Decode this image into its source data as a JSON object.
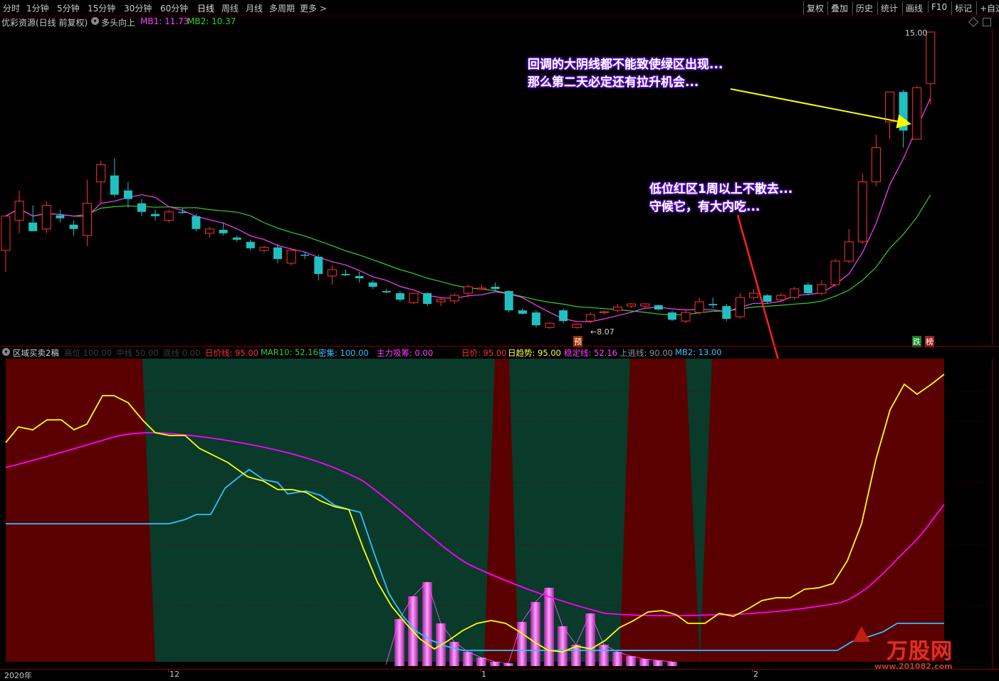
{
  "toolbar": {
    "periods": [
      "分时",
      "1分钟",
      "5分钟",
      "15分钟",
      "30分钟",
      "60分钟",
      "日线",
      "周线",
      "月线",
      "多周期",
      "更多 >"
    ],
    "right_buttons": [
      "复权",
      "叠加",
      "历史",
      "统计",
      "画线",
      "F10",
      "标记",
      "+自选"
    ]
  },
  "main_title": {
    "stock": "优彩资源(日线 前复权)",
    "indicator": "多头向上",
    "mb1": "MB1: 11.73",
    "mb2": "MB2: 10.37"
  },
  "labels": {
    "high_price": "15.00",
    "low_price": "8.07",
    "pre_marker": "预",
    "tag1": "跌",
    "tag2": "榜"
  },
  "annotations": {
    "a1_line1": "回调的大阴线都不能致使绿区出现...",
    "a1_line2": "那么第二天必定还有拉升机会...",
    "a2_line1": "低位红区1周以上不散去...",
    "a2_line2": "守候它，有大内吃..."
  },
  "indicator_row": {
    "name": "区域买卖2稿",
    "ghost1": "高位 100.00",
    "ghost2": "中线 50.00",
    "ghost3": "底线 0.00",
    "rijia": "日价线: 95.00",
    "mar10": "MAR10: 52.16",
    "miji": "密集: 100.00",
    "zhuli": "主力吸筹: 0.00",
    "rijia2": "日价: 95.00",
    "riqushi": "日趋势: 95.00",
    "wending": "稳定线: 52.16",
    "shangtao": "上逃线: 90.00",
    "mb2": "MB2: 13.00"
  },
  "dates": {
    "year": "2020年",
    "d12": "12",
    "d1": "1",
    "d2": "2"
  },
  "watermark": {
    "logo": "万股网",
    "url": "www.201082.com"
  },
  "colors": {
    "up": "#ff3232",
    "down": "#20c0c0",
    "ma_fast": "#ff40ff",
    "ma_slow": "#30d030",
    "zone_red": "#5a0000",
    "zone_green": "#0a3a2a",
    "yellow": "#ffff00",
    "magenta": "#ff00ff",
    "cyan": "#30c0ff",
    "bar_pink": "#ff60ff"
  },
  "chart_data": [
    {
      "type": "candlestick",
      "title": "优彩资源(日线 前复权)",
      "note": "OHLC estimated from the price ticks, which are not printed except for the marked extremes 15.00 and 8.07",
      "candles": [
        {
          "o": 9.9,
          "h": 10.6,
          "l": 9.4,
          "c": 10.7,
          "dir": "up"
        },
        {
          "o": 10.6,
          "h": 11.3,
          "l": 10.3,
          "c": 11.05,
          "dir": "up"
        },
        {
          "o": 10.55,
          "h": 10.95,
          "l": 10.35,
          "c": 10.35,
          "dir": "down"
        },
        {
          "o": 10.4,
          "h": 11.05,
          "l": 10.3,
          "c": 10.95,
          "dir": "up"
        },
        {
          "o": 10.72,
          "h": 10.85,
          "l": 10.55,
          "c": 10.65,
          "dir": "down"
        },
        {
          "o": 10.4,
          "h": 10.6,
          "l": 10.25,
          "c": 10.5,
          "dir": "down"
        },
        {
          "o": 10.25,
          "h": 11.55,
          "l": 10.0,
          "c": 11.0,
          "dir": "up"
        },
        {
          "o": 11.5,
          "h": 12.0,
          "l": 11.0,
          "c": 11.9,
          "dir": "up"
        },
        {
          "o": 11.65,
          "h": 12.05,
          "l": 11.15,
          "c": 11.2,
          "dir": "down"
        },
        {
          "o": 11.3,
          "h": 11.5,
          "l": 10.9,
          "c": 11.1,
          "dir": "down"
        },
        {
          "o": 11.0,
          "h": 11.1,
          "l": 10.7,
          "c": 10.8,
          "dir": "down"
        },
        {
          "o": 10.75,
          "h": 10.85,
          "l": 10.6,
          "c": 10.7,
          "dir": "down"
        },
        {
          "o": 10.6,
          "h": 10.85,
          "l": 10.55,
          "c": 10.8,
          "dir": "up"
        },
        {
          "o": 10.8,
          "h": 10.9,
          "l": 10.75,
          "c": 10.78,
          "dir": "down"
        },
        {
          "o": 10.7,
          "h": 10.75,
          "l": 10.35,
          "c": 10.4,
          "dir": "down"
        },
        {
          "o": 10.3,
          "h": 10.45,
          "l": 10.2,
          "c": 10.4,
          "dir": "up"
        },
        {
          "o": 10.38,
          "h": 10.55,
          "l": 10.25,
          "c": 10.3,
          "dir": "down"
        },
        {
          "o": 10.2,
          "h": 10.25,
          "l": 10.1,
          "c": 10.15,
          "dir": "down"
        },
        {
          "o": 10.1,
          "h": 10.15,
          "l": 9.9,
          "c": 9.95,
          "dir": "down"
        },
        {
          "o": 9.9,
          "h": 10.0,
          "l": 9.85,
          "c": 9.97,
          "dir": "up"
        },
        {
          "o": 9.97,
          "h": 10.05,
          "l": 9.6,
          "c": 9.7,
          "dir": "down"
        },
        {
          "o": 9.6,
          "h": 9.95,
          "l": 9.55,
          "c": 9.9,
          "dir": "up"
        },
        {
          "o": 9.8,
          "h": 9.85,
          "l": 9.7,
          "c": 9.78,
          "dir": "down"
        },
        {
          "o": 9.75,
          "h": 9.8,
          "l": 9.2,
          "c": 9.35,
          "dir": "down"
        },
        {
          "o": 9.3,
          "h": 9.55,
          "l": 9.1,
          "c": 9.45,
          "dir": "up"
        },
        {
          "o": 9.35,
          "h": 9.45,
          "l": 9.3,
          "c": 9.32,
          "dir": "down"
        },
        {
          "o": 9.3,
          "h": 9.4,
          "l": 9.15,
          "c": 9.25,
          "dir": "down"
        },
        {
          "o": 9.15,
          "h": 9.2,
          "l": 9.0,
          "c": 9.05,
          "dir": "down"
        },
        {
          "o": 8.95,
          "h": 9.0,
          "l": 8.9,
          "c": 8.92,
          "dir": "down"
        },
        {
          "o": 8.9,
          "h": 8.95,
          "l": 8.7,
          "c": 8.75,
          "dir": "down"
        },
        {
          "o": 8.68,
          "h": 8.92,
          "l": 8.65,
          "c": 8.9,
          "dir": "up"
        },
        {
          "o": 8.9,
          "h": 8.92,
          "l": 8.6,
          "c": 8.65,
          "dir": "down"
        },
        {
          "o": 8.7,
          "h": 8.8,
          "l": 8.6,
          "c": 8.75,
          "dir": "up"
        },
        {
          "o": 8.72,
          "h": 8.9,
          "l": 8.65,
          "c": 8.85,
          "dir": "up"
        },
        {
          "o": 8.9,
          "h": 9.1,
          "l": 8.8,
          "c": 9.05,
          "dir": "up"
        },
        {
          "o": 9.0,
          "h": 9.1,
          "l": 8.98,
          "c": 9.02,
          "dir": "up"
        },
        {
          "o": 9.05,
          "h": 9.15,
          "l": 8.95,
          "c": 9.0,
          "dir": "down"
        },
        {
          "o": 8.95,
          "h": 8.97,
          "l": 8.45,
          "c": 8.5,
          "dir": "down"
        },
        {
          "o": 8.5,
          "h": 8.55,
          "l": 8.4,
          "c": 8.42,
          "dir": "down"
        },
        {
          "o": 8.45,
          "h": 8.5,
          "l": 8.1,
          "c": 8.15,
          "dir": "down"
        },
        {
          "o": 8.1,
          "h": 8.22,
          "l": 8.07,
          "c": 8.2,
          "dir": "up"
        },
        {
          "o": 8.5,
          "h": 8.55,
          "l": 8.2,
          "c": 8.25,
          "dir": "down"
        },
        {
          "o": 8.1,
          "h": 8.2,
          "l": 8.07,
          "c": 8.18,
          "dir": "up"
        },
        {
          "o": 8.25,
          "h": 8.45,
          "l": 8.2,
          "c": 8.4,
          "dir": "up"
        },
        {
          "o": 8.45,
          "h": 8.5,
          "l": 8.4,
          "c": 8.47,
          "dir": "up"
        },
        {
          "o": 8.5,
          "h": 8.65,
          "l": 8.45,
          "c": 8.58,
          "dir": "up"
        },
        {
          "o": 8.6,
          "h": 8.67,
          "l": 8.55,
          "c": 8.65,
          "dir": "up"
        },
        {
          "o": 8.6,
          "h": 8.67,
          "l": 8.55,
          "c": 8.65,
          "dir": "up"
        },
        {
          "o": 8.62,
          "h": 8.63,
          "l": 8.5,
          "c": 8.52,
          "dir": "down"
        },
        {
          "o": 8.45,
          "h": 8.5,
          "l": 8.25,
          "c": 8.28,
          "dir": "down"
        },
        {
          "o": 8.25,
          "h": 8.5,
          "l": 8.2,
          "c": 8.45,
          "dir": "up"
        },
        {
          "o": 8.45,
          "h": 8.8,
          "l": 8.4,
          "c": 8.7,
          "dir": "up"
        },
        {
          "o": 8.65,
          "h": 8.8,
          "l": 8.55,
          "c": 8.62,
          "dir": "down"
        },
        {
          "o": 8.6,
          "h": 8.65,
          "l": 8.25,
          "c": 8.3,
          "dir": "down"
        },
        {
          "o": 8.35,
          "h": 8.9,
          "l": 8.3,
          "c": 8.8,
          "dir": "up"
        },
        {
          "o": 8.8,
          "h": 9.0,
          "l": 8.75,
          "c": 8.9,
          "dir": "up"
        },
        {
          "o": 8.85,
          "h": 8.88,
          "l": 8.65,
          "c": 8.7,
          "dir": "down"
        },
        {
          "o": 8.75,
          "h": 8.9,
          "l": 8.7,
          "c": 8.85,
          "dir": "up"
        },
        {
          "o": 8.8,
          "h": 9.05,
          "l": 8.75,
          "c": 9.0,
          "dir": "up"
        },
        {
          "o": 9.1,
          "h": 9.15,
          "l": 8.85,
          "c": 8.9,
          "dir": "down"
        },
        {
          "o": 8.9,
          "h": 9.2,
          "l": 8.85,
          "c": 9.1,
          "dir": "up"
        },
        {
          "o": 9.1,
          "h": 9.7,
          "l": 9.05,
          "c": 9.65,
          "dir": "up"
        },
        {
          "o": 9.65,
          "h": 10.4,
          "l": 9.6,
          "c": 10.1,
          "dir": "up"
        },
        {
          "o": 10.1,
          "h": 11.7,
          "l": 10.05,
          "c": 11.5,
          "dir": "up"
        },
        {
          "o": 11.5,
          "h": 12.6,
          "l": 11.4,
          "c": 12.3,
          "dir": "up"
        },
        {
          "o": 12.9,
          "h": 13.5,
          "l": 12.5,
          "c": 13.6,
          "dir": "up"
        },
        {
          "o": 13.6,
          "h": 13.65,
          "l": 12.3,
          "c": 12.7,
          "dir": "down"
        },
        {
          "o": 12.5,
          "h": 13.75,
          "l": 12.5,
          "c": 13.7,
          "dir": "up"
        },
        {
          "o": 13.8,
          "h": 15.0,
          "l": 13.3,
          "c": 15.0,
          "dir": "up"
        }
      ]
    }
  ]
}
